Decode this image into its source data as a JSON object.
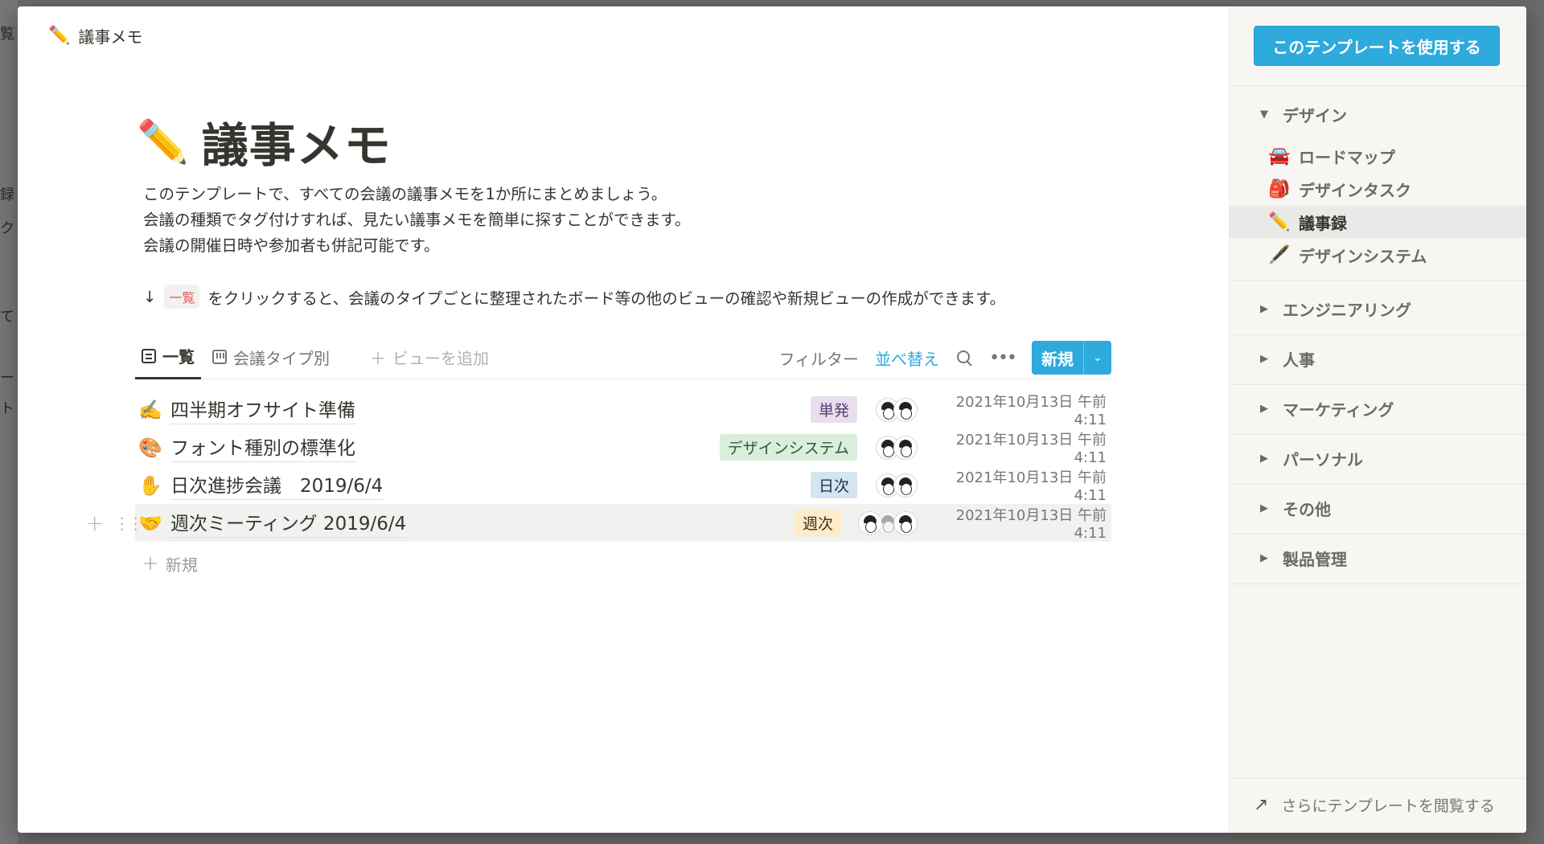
{
  "background": {
    "peek_texts": [
      "覧",
      "録",
      "ク",
      "て",
      "ー",
      "ト"
    ]
  },
  "breadcrumb": {
    "emoji": "✏️",
    "title": "議事メモ"
  },
  "page": {
    "emoji": "✏️",
    "title": "議事メモ",
    "description": [
      "このテンプレートで、すべての会議の議事メモを1か所にまとめましょう。",
      "会議の種類でタグ付けすれば、見たい議事メモを簡単に探すことができます。",
      "会議の開催日時や参加者も併記可能です。"
    ],
    "hint": {
      "arrow": "↓",
      "code": "一覧",
      "text": "をクリックすると、会議のタイプごとに整理されたボード等の他のビューの確認や新規ビューの作成ができます。"
    }
  },
  "views": {
    "tabs": [
      {
        "label": "一覧",
        "active": true
      },
      {
        "label": "会議タイプ別",
        "active": false
      }
    ],
    "add_view": "ビューを追加",
    "add_plus": "＋"
  },
  "toolbar": {
    "filter": "フィルター",
    "sort": "並べ替え",
    "more": "•••",
    "new_label": "新規",
    "new_caret": "⌄"
  },
  "rows": [
    {
      "emoji": "✍️",
      "title": "四半期オフサイト準備",
      "tag": "単発",
      "tag_bg": "#e8deee",
      "tag_color": "#5a3f72",
      "date": "2021年10月13日 午前 4:11"
    },
    {
      "emoji": "🎨",
      "title": "フォント種別の標準化",
      "tag": "デザインシステム",
      "tag_bg": "#dbeddb",
      "tag_color": "#2b593f",
      "date": "2021年10月13日 午前 4:11"
    },
    {
      "emoji": "✋",
      "title": "日次進捗会議　2019/6/4",
      "tag": "日次",
      "tag_bg": "#d3e5ef",
      "tag_color": "#183347",
      "date": "2021年10月13日 午前 4:11"
    },
    {
      "emoji": "🤝",
      "title": "週次ミーティング 2019/6/4",
      "tag": "週次",
      "tag_bg": "#fdecc8",
      "tag_color": "#402c1b",
      "date": "2021年10月13日 午前 4:11"
    }
  ],
  "row_handle": {
    "plus": "+",
    "drag": "⋮⋮"
  },
  "add_row": {
    "plus": "+",
    "label": "新規"
  },
  "sidebar": {
    "use_template": "このテンプレートを使用する",
    "sections": [
      {
        "label": "デザイン",
        "expanded": true,
        "tri": "▼"
      },
      {
        "label": "エンジニアリング",
        "tri": "▶"
      },
      {
        "label": "人事",
        "tri": "▶"
      },
      {
        "label": "マーケティング",
        "tri": "▶"
      },
      {
        "label": "パーソナル",
        "tri": "▶"
      },
      {
        "label": "その他",
        "tri": "▶"
      },
      {
        "label": "製品管理",
        "tri": "▶"
      }
    ],
    "design_items": [
      {
        "emoji": "🚘",
        "label": "ロードマップ"
      },
      {
        "emoji": "🎒",
        "label": "デザインタスク"
      },
      {
        "emoji": "✏️",
        "label": "議事録"
      },
      {
        "emoji": "🖋️",
        "label": "デザインシステム"
      }
    ],
    "footer": {
      "arrow": "↗",
      "label": "さらにテンプレートを閲覧する"
    }
  },
  "colors": {
    "accent": "#2eaadc",
    "text": "#37352f",
    "muted": "#787774",
    "sidebar_bg": "#f7f6f3"
  }
}
